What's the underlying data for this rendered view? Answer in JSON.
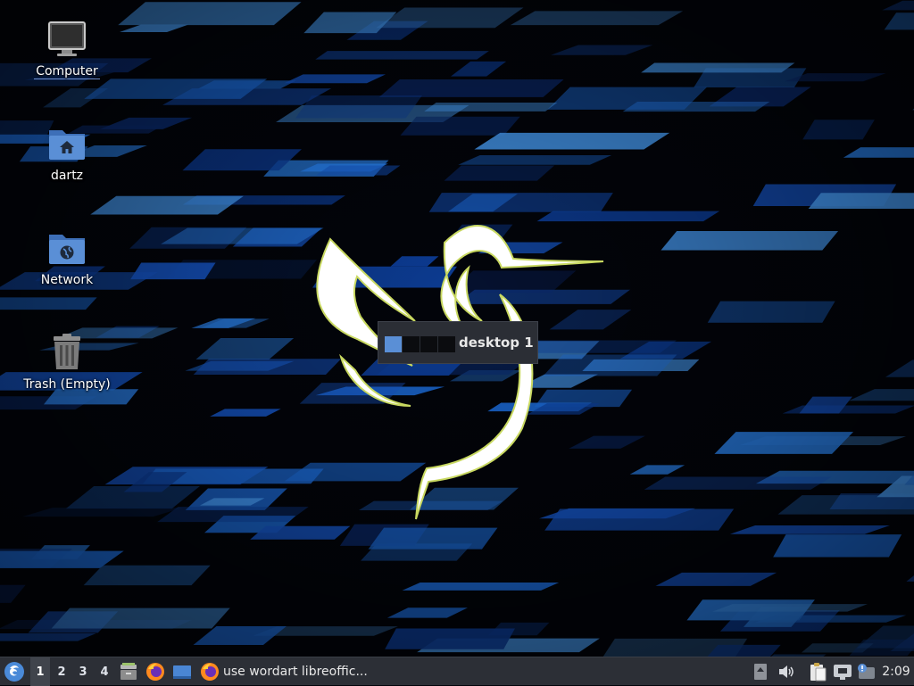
{
  "desktop": {
    "icons": [
      {
        "name": "computer",
        "label": "Computer",
        "icon": "monitor-icon"
      },
      {
        "name": "home",
        "label": "dartz",
        "icon": "home-folder-icon"
      },
      {
        "name": "network",
        "label": "Network",
        "icon": "network-folder-icon"
      },
      {
        "name": "trash",
        "label": "Trash (Empty)",
        "icon": "trash-icon"
      }
    ]
  },
  "workspace_popup": {
    "name": "desktop 1",
    "workspace_count": 4,
    "active_index": 1
  },
  "taskbar": {
    "menu_icon": "start-menu-icon",
    "workspaces": [
      "1",
      "2",
      "3",
      "4"
    ],
    "active_workspace": "1",
    "launchers": [
      "file-manager-icon",
      "firefox-icon",
      "show-desktop-icon"
    ],
    "task": {
      "icon": "firefox-icon",
      "label": "use wordart libreoffic..."
    },
    "tray_icons": [
      "update-arrow-icon",
      "volume-icon",
      "clipboard-icon",
      "network-icon",
      "notification-icon"
    ],
    "clock": "2:09"
  },
  "colors": {
    "accent": "#5a8fd6",
    "taskbar_bg": "#2c2f36",
    "wallpaper_bg": "#02040a",
    "wallpaper_blue": "#1d6fe0"
  }
}
